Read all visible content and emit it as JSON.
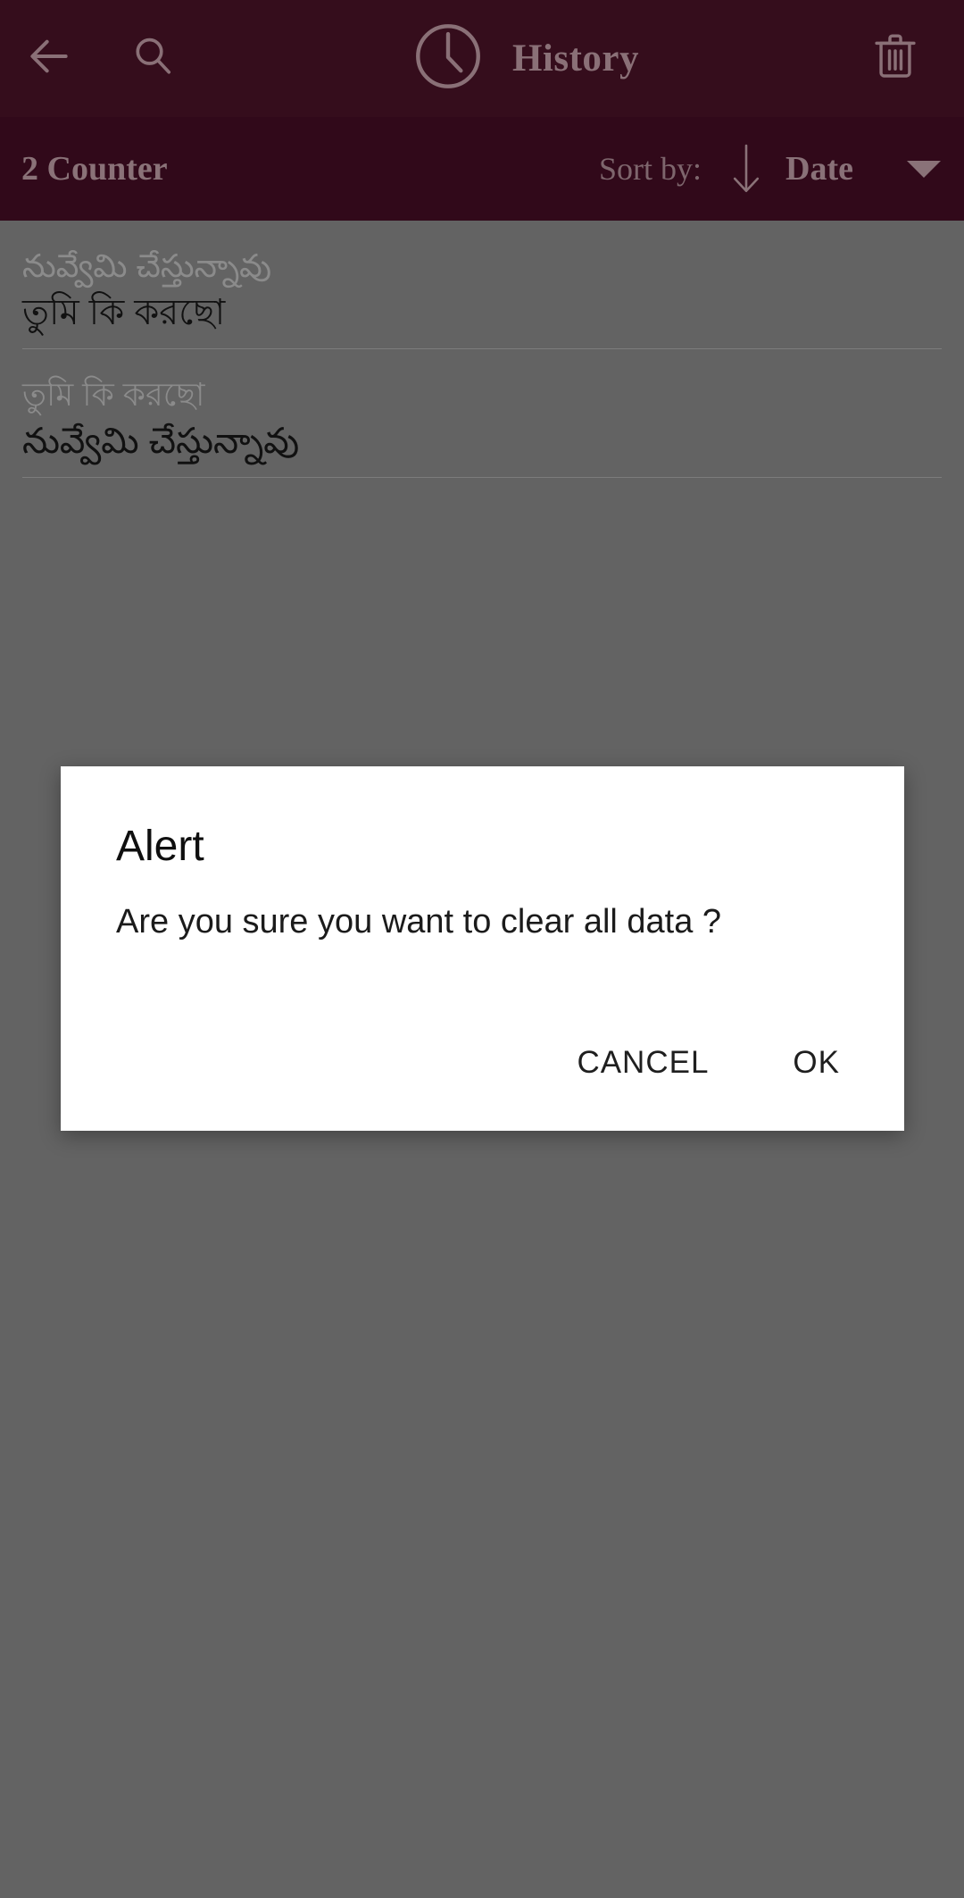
{
  "appbar": {
    "back_icon": "arrow-left-icon",
    "search_icon": "search-icon",
    "clock_icon": "clock-icon",
    "title": "History",
    "delete_icon": "trash-icon",
    "background_color": "#350d1c",
    "foreground_color": "#8a7077"
  },
  "sortbar": {
    "counter_label": "2 Counter",
    "sort_by_label": "Sort by:",
    "sort_direction_icon": "arrow-down-icon",
    "sort_field": "Date",
    "caret_icon": "triangle-down-icon",
    "background_color": "#31091a"
  },
  "history": {
    "items": [
      {
        "source_text": "నువ్వేమి చేస్తున్నావు",
        "target_text": "তুমি কি করছো"
      },
      {
        "source_text": "তুমি কি করছো",
        "target_text": "నువ్వేమి చేస్తున్నావు"
      }
    ]
  },
  "dialog": {
    "title": "Alert",
    "message": "Are you sure you want to clear all data ?",
    "cancel_label": "CANCEL",
    "ok_label": "OK",
    "background_color": "#ffffff"
  },
  "colors": {
    "scrim": "#636363",
    "divider": "#7c7c7c",
    "source_text": "#8b8b8b",
    "target_text": "#111111"
  }
}
